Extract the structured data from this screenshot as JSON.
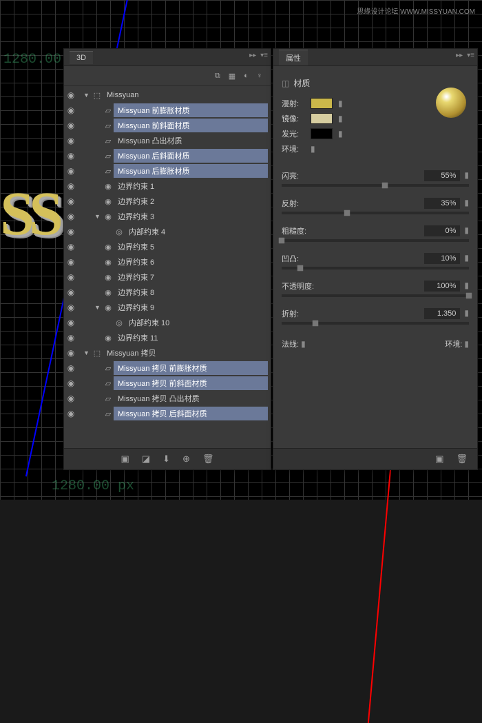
{
  "watermark": "思缘设计论坛 WWW.MISSYUAN.COM",
  "coord_top": "1280.00 px",
  "coord_bottom": "1280.00 px",
  "panel3d": {
    "title": "3D"
  },
  "tree": [
    {
      "depth": 0,
      "arrow": "▼",
      "icon": "scene",
      "label": "Missyuan",
      "sel": false
    },
    {
      "depth": 1,
      "arrow": "",
      "icon": "mat",
      "label": "Missyuan 前膨胀材质",
      "sel": true
    },
    {
      "depth": 1,
      "arrow": "",
      "icon": "mat",
      "label": "Missyuan 前斜面材质",
      "sel": true
    },
    {
      "depth": 1,
      "arrow": "",
      "icon": "mat",
      "label": "Missyuan 凸出材质",
      "sel": false
    },
    {
      "depth": 1,
      "arrow": "",
      "icon": "mat",
      "label": "Missyuan 后斜面材质",
      "sel": true
    },
    {
      "depth": 1,
      "arrow": "",
      "icon": "mat",
      "label": "Missyuan 后膨胀材质",
      "sel": true
    },
    {
      "depth": 1,
      "arrow": "",
      "icon": "dot",
      "label": "边界约束 1",
      "sel": false
    },
    {
      "depth": 1,
      "arrow": "",
      "icon": "dot",
      "label": "边界约束 2",
      "sel": false
    },
    {
      "depth": 1,
      "arrow": "▼",
      "icon": "dot",
      "label": "边界约束 3",
      "sel": false
    },
    {
      "depth": 2,
      "arrow": "",
      "icon": "ring",
      "label": "内部约束 4",
      "sel": false
    },
    {
      "depth": 1,
      "arrow": "",
      "icon": "dot",
      "label": "边界约束 5",
      "sel": false
    },
    {
      "depth": 1,
      "arrow": "",
      "icon": "dot",
      "label": "边界约束 6",
      "sel": false
    },
    {
      "depth": 1,
      "arrow": "",
      "icon": "dot",
      "label": "边界约束 7",
      "sel": false
    },
    {
      "depth": 1,
      "arrow": "",
      "icon": "dot",
      "label": "边界约束 8",
      "sel": false
    },
    {
      "depth": 1,
      "arrow": "▼",
      "icon": "dot",
      "label": "边界约束 9",
      "sel": false
    },
    {
      "depth": 2,
      "arrow": "",
      "icon": "ring",
      "label": "内部约束 10",
      "sel": false
    },
    {
      "depth": 1,
      "arrow": "",
      "icon": "dot",
      "label": "边界约束 11",
      "sel": false
    },
    {
      "depth": 0,
      "arrow": "▼",
      "icon": "scene",
      "label": "Missyuan 拷贝",
      "sel": false
    },
    {
      "depth": 1,
      "arrow": "",
      "icon": "mat",
      "label": "Missyuan 拷贝 前膨胀材质",
      "sel": true
    },
    {
      "depth": 1,
      "arrow": "",
      "icon": "mat",
      "label": "Missyuan 拷贝 前斜面材质",
      "sel": true
    },
    {
      "depth": 1,
      "arrow": "",
      "icon": "mat",
      "label": "Missyuan 拷贝 凸出材质",
      "sel": false
    },
    {
      "depth": 1,
      "arrow": "",
      "icon": "mat",
      "label": "Missyuan 拷贝 后斜面材质",
      "sel": true
    }
  ],
  "props": {
    "title": "属性",
    "section": "材质",
    "rows": [
      {
        "label": "漫射:",
        "color": "#cbb84a"
      },
      {
        "label": "镜像:",
        "color": "#d6cda0"
      },
      {
        "label": "发光:",
        "color": "#000000"
      },
      {
        "label": "环境:",
        "color": ""
      }
    ],
    "sliders": [
      {
        "label": "闪亮:",
        "value": "55%",
        "pct": 55
      },
      {
        "label": "反射:",
        "value": "35%",
        "pct": 35
      },
      {
        "label": "粗糙度:",
        "value": "0%",
        "pct": 0
      },
      {
        "label": "凹凸:",
        "value": "10%",
        "pct": 10
      },
      {
        "label": "不透明度:",
        "value": "100%",
        "pct": 100
      },
      {
        "label": "折射:",
        "value": "1.350",
        "pct": 18
      }
    ],
    "normal": "法线:",
    "env": "环境:"
  }
}
